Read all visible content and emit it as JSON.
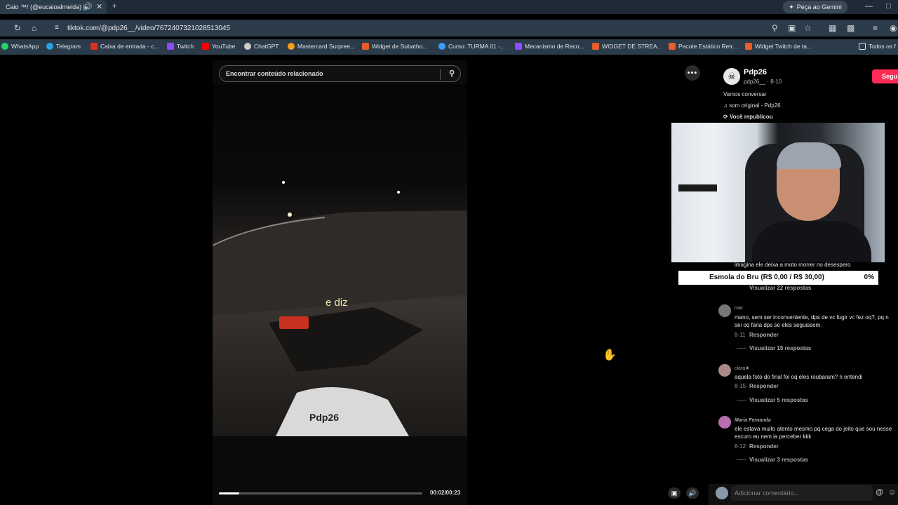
{
  "browser": {
    "tab_title": "Caio ™/ (@eucaioalmeida) |",
    "gemini_label": "Peça ao Gemini",
    "url": "tiktok.com/@pdp26__/video/7672407321028513045"
  },
  "bookmarks": [
    {
      "label": "WhatsApp",
      "color": "#25d366"
    },
    {
      "label": "Telegram",
      "color": "#2aa3e0"
    },
    {
      "label": "Caixa de entrada - c...",
      "color": "#d93025"
    },
    {
      "label": "Twitch",
      "color": "#9146ff"
    },
    {
      "label": "YouTube",
      "color": "#ff0000"
    },
    {
      "label": "ChatGPT",
      "color": "#cccccc"
    },
    {
      "label": "Mastercard Surpree...",
      "color": "#f79e1b"
    },
    {
      "label": "Widget de Subatho...",
      "color": "#e85d2a"
    },
    {
      "label": "Curso: TURMA 01 -...",
      "color": "#3aa0ff"
    },
    {
      "label": "Mecanismo de Reco...",
      "color": "#8a4dff"
    },
    {
      "label": "WIDGET DE STREA...",
      "color": "#e85d2a"
    },
    {
      "label": "Pacote Estático Retr...",
      "color": "#e85d2a"
    },
    {
      "label": "Widget Twitch de ta...",
      "color": "#e85d2a"
    }
  ],
  "bookmarks_folder": "Todos os f",
  "video": {
    "search_placeholder": "Encontrar conteúdo relacionado",
    "caption": "e diz",
    "time": "00:02/00:23",
    "progress": 0.1
  },
  "author": {
    "name": "Pdp26",
    "handle": "pdp26__ · 8-10",
    "follow_label": "Segu",
    "description": "Vamos conversar",
    "sound": "som original - Pdp26",
    "repost": "Você republicou"
  },
  "goal": {
    "label": "Esmola do Bru (R$ 0,00 / R$ 30,00)",
    "percent": "0%"
  },
  "comments": {
    "partial_text": "imagina ele deixa a moto morrer no desespero",
    "partial_replies": "Visualizar 22 respostas",
    "items": [
      {
        "user": "nao",
        "text": "mano, sem ser inconveniente, dps de vc fugir vc fez oq?, pq n sei oq faria dps se eles seguissem.",
        "date": "8-11",
        "reply": "Responder",
        "replies": "Visualizar 15 respostas"
      },
      {
        "user": "clara★",
        "text": "aquela foto do final foi oq eles roubaram? n entendi",
        "date": "8-15",
        "reply": "Responder",
        "replies": "Visualizar 5 respostas"
      },
      {
        "user": "Maria Fernanda",
        "text": "ele estava muito atento mesmo pq cega do jeito que sou nesse escuro eu nem ia perceber kkk",
        "date": "8-12",
        "reply": "Responder",
        "replies": "Visualizar 3 respostas"
      }
    ],
    "add_placeholder": "Adicionar comentário..."
  },
  "colors": {
    "accent": "#fe2c55"
  }
}
